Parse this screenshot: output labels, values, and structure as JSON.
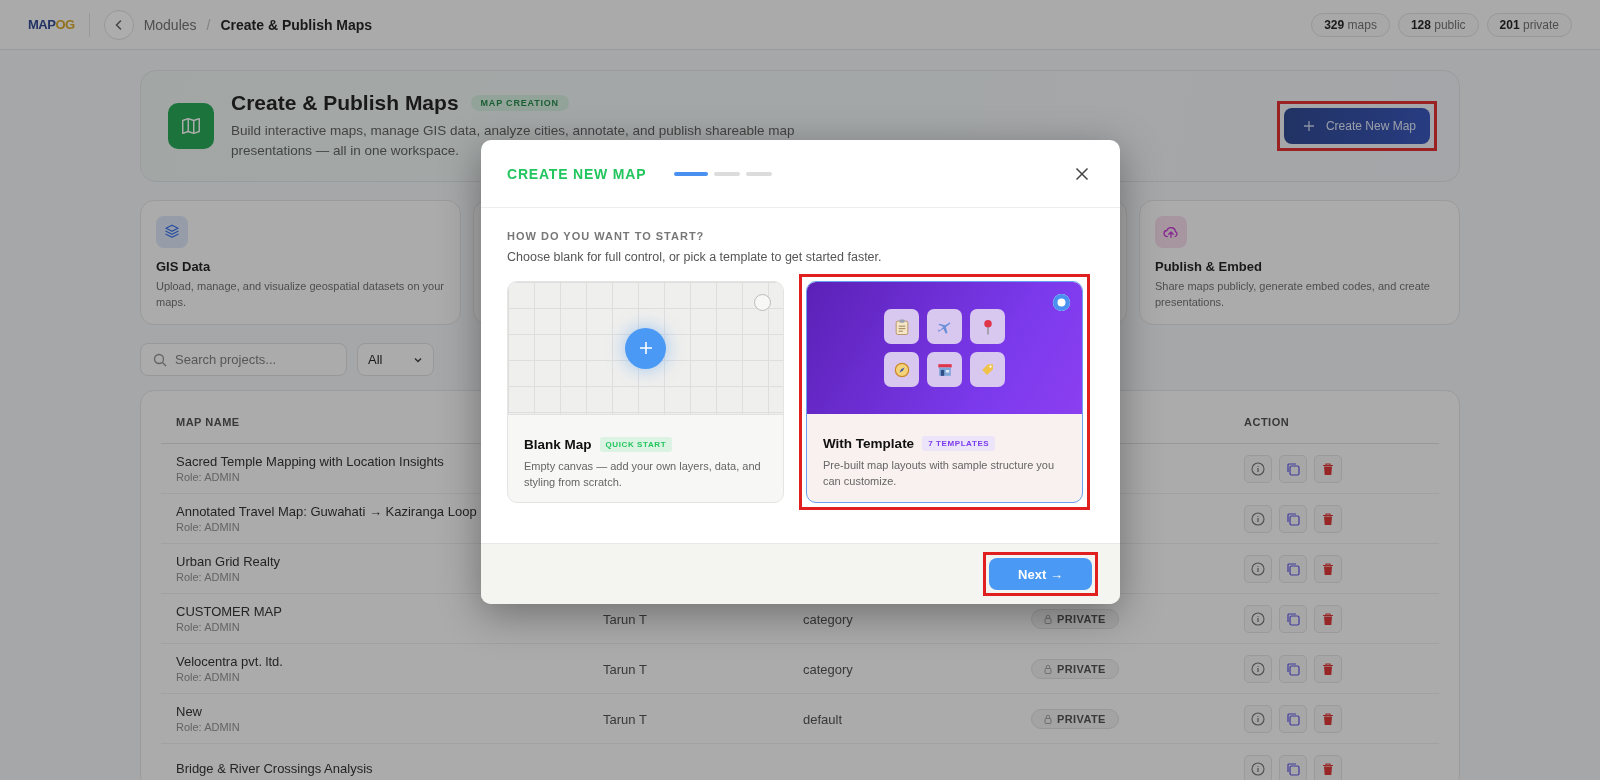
{
  "topbar": {
    "logo": {
      "primary": "MAP",
      "secondary": "OG"
    },
    "breadcrumb": [
      "Modules",
      "Create & Publish Maps"
    ],
    "breadcrumb_separator": "/",
    "stats": [
      "**329** maps",
      "**128** public",
      "**201** private"
    ]
  },
  "hero": {
    "title": "Create & Publish Maps",
    "badge": "MAP CREATION",
    "description": "Build interactive maps, manage GIS data, analyze cities, annotate, and publish shareable map presentations — all in one workspace.",
    "button": {
      "label": "Create New Map",
      "highlighted": true
    }
  },
  "features": [
    {
      "kind": "layers",
      "title": "GIS Data",
      "description": "Upload, manage, and visualize geospatial datasets on your maps."
    },
    {
      "kind": "hidden"
    },
    {
      "kind": "hidden"
    },
    {
      "kind": "upload",
      "title": "Publish & Embed",
      "description": "Share maps publicly, generate embed codes, and create presentations."
    }
  ],
  "search": {
    "placeholder": "Search projects..."
  },
  "filter": {
    "value": "All"
  },
  "table": {
    "columns": [
      "MAP NAME",
      "ACTION"
    ],
    "rows": [
      {
        "name": "Sacred Temple Mapping with Location Insights",
        "role": "Role: ADMIN"
      },
      {
        "name": "Annotated Travel Map: Guwahati → Kaziranga Loop",
        "role": "Role: ADMIN"
      },
      {
        "name": "Urban Grid Realty",
        "role": "Role: ADMIN"
      },
      {
        "name": "CUSTOMER MAP",
        "role": "Role: ADMIN",
        "owner": "Tarun T",
        "category": "category",
        "visibility": "PRIVATE"
      },
      {
        "name": "Velocentra pvt. ltd.",
        "role": "Role: ADMIN",
        "owner": "Tarun T",
        "category": "category",
        "visibility": "PRIVATE"
      },
      {
        "name": "New",
        "role": "Role: ADMIN",
        "owner": "Tarun T",
        "category": "default",
        "visibility": "PRIVATE"
      },
      {
        "name": "Bridge & River Crossings Analysis"
      }
    ]
  },
  "modal": {
    "title": "CREATE NEW MAP",
    "steps": [
      {
        "active": true
      },
      {
        "active": false
      },
      {
        "active": false
      }
    ],
    "question": "HOW DO YOU WANT TO START?",
    "subtitle": "Choose blank for full control, or pick a template to get started faster.",
    "options": [
      {
        "kind": "blank",
        "title": "Blank Map",
        "badge": "QUICK START",
        "description": "Empty canvas — add your own layers, data, and styling from scratch.",
        "selected": false,
        "highlighted": false
      },
      {
        "kind": "template",
        "title": "With Template",
        "badge": "7 TEMPLATES",
        "description": "Pre-built map layouts with sample structure you can customize.",
        "selected": true,
        "highlighted": true
      }
    ],
    "next": {
      "label": "Next →",
      "highlighted": true
    }
  }
}
